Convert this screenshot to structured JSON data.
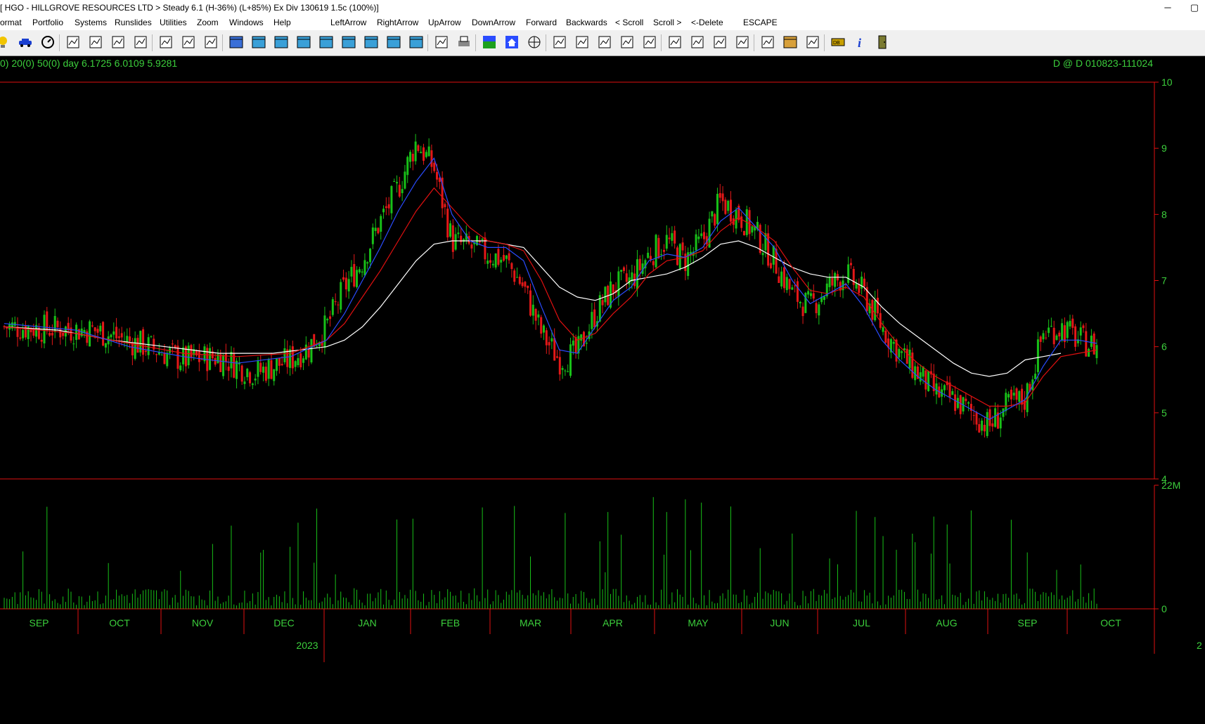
{
  "window": {
    "title": "[ HGO - HILLGROVE RESOURCES LTD > Steady 6.1 (H-36%) (L+85%)    Ex Div 130619  1.5c  (100%)]",
    "minimize_glyph": "─",
    "maximize_glyph": "▢"
  },
  "menu": {
    "items": [
      "ormat",
      "Portfolio",
      "Systems",
      "Runslides",
      "Utilities",
      "Zoom",
      "Windows",
      "Help"
    ],
    "nav_items": [
      "LeftArrow",
      "RightArrow",
      "UpArrow",
      "DownArrow",
      "Forward",
      "Backwards",
      "< Scroll",
      "Scroll >",
      "<-Delete",
      "ESCAPE"
    ]
  },
  "toolbar": {
    "buttons": [
      {
        "icon": "bulb-icon"
      },
      {
        "icon": "car-icon"
      },
      {
        "icon": "dial-icon"
      },
      {
        "icon": "chart-options-icon"
      },
      {
        "icon": "table-icon"
      },
      {
        "icon": "draw-trend-icon"
      },
      {
        "icon": "indicator-icon"
      },
      {
        "icon": "pfolio-icon"
      },
      {
        "icon": "grid-icon"
      },
      {
        "icon": "stats-icon"
      },
      {
        "icon": "window-icon"
      },
      {
        "icon": "cascade-icon"
      },
      {
        "icon": "tile-vertical-icon"
      },
      {
        "icon": "tile-horizontal-icon"
      },
      {
        "icon": "zoom-box-icon"
      },
      {
        "icon": "zoom-v-icon"
      },
      {
        "icon": "zoom-b-icon"
      },
      {
        "icon": "overlay-icon"
      },
      {
        "icon": "stack-icon"
      },
      {
        "icon": "print-preview-icon"
      },
      {
        "icon": "printer-icon"
      },
      {
        "icon": "map-icon"
      },
      {
        "icon": "home-icon"
      },
      {
        "icon": "web-icon"
      },
      {
        "icon": "scroll-left-full-icon"
      },
      {
        "icon": "scroll-left-icon"
      },
      {
        "icon": "scroll-back-icon"
      },
      {
        "icon": "scroll-right-icon"
      },
      {
        "icon": "scroll-right-full-icon"
      },
      {
        "icon": "dwm-icon"
      },
      {
        "icon": "log-lin-icon"
      },
      {
        "icon": "candle-icon"
      },
      {
        "icon": "show-trade-icon"
      },
      {
        "icon": "data-f12-icon"
      },
      {
        "icon": "hj-icon"
      },
      {
        "icon": "notes-icon"
      },
      {
        "icon": "database-icon"
      },
      {
        "icon": "info-icon"
      },
      {
        "icon": "exit-icon"
      }
    ]
  },
  "chart_header": {
    "left": "0) 20(0) 50(0)  day      6.1725  6.0109  5.9281",
    "right": "D @ D   010823-111024"
  },
  "colors": {
    "up": "#18c018",
    "down": "#e41818",
    "ma_fast": "#2a4cff",
    "ma_mid": "#e01010",
    "ma_slow": "#ffffff",
    "axis": "#e01010",
    "text": "#3ccf3c",
    "volume": "#18c018"
  },
  "chart_data": {
    "type": "candlestick",
    "series_note": "daily OHLC with three moving averages and volume",
    "price_axis": {
      "min": 4,
      "max": 10,
      "ticks": [
        4,
        5,
        6,
        7,
        8,
        9,
        10
      ]
    },
    "volume_axis": {
      "min": 0,
      "max": 22000000,
      "tick_labels": [
        "22M",
        "0"
      ]
    },
    "months": [
      "SEP",
      "OCT",
      "NOV",
      "DEC",
      "JAN",
      "FEB",
      "MAR",
      "APR",
      "MAY",
      "JUN",
      "JUL",
      "AUG",
      "SEP",
      "OCT"
    ],
    "year_label": "2023",
    "right_edge_label": "2",
    "close_path": [
      [
        0,
        6.3
      ],
      [
        5,
        6.25
      ],
      [
        8,
        6.0
      ],
      [
        10,
        5.8
      ],
      [
        12,
        5.85
      ],
      [
        14,
        5.6
      ],
      [
        16,
        5.8
      ],
      [
        17,
        6.0
      ],
      [
        18,
        6.3
      ],
      [
        19,
        6.9
      ],
      [
        20,
        7.3
      ],
      [
        21,
        7.9
      ],
      [
        22,
        8.4
      ],
      [
        23,
        9.1
      ],
      [
        24,
        8.7
      ],
      [
        25,
        7.6
      ],
      [
        27,
        7.4
      ],
      [
        28,
        7.3
      ],
      [
        29,
        6.9
      ],
      [
        30,
        6.2
      ],
      [
        31,
        5.8
      ],
      [
        32,
        5.9
      ],
      [
        33,
        6.5
      ],
      [
        34,
        6.9
      ],
      [
        35,
        7.0
      ],
      [
        36,
        7.4
      ],
      [
        37,
        7.6
      ],
      [
        38,
        7.3
      ],
      [
        39,
        7.6
      ],
      [
        40,
        8.2
      ],
      [
        41,
        8.0
      ],
      [
        42,
        7.7
      ],
      [
        43,
        7.3
      ],
      [
        44,
        6.8
      ],
      [
        45,
        6.6
      ],
      [
        46,
        6.9
      ],
      [
        47,
        7.1
      ],
      [
        48,
        6.8
      ],
      [
        49,
        6.3
      ],
      [
        50,
        5.9
      ],
      [
        51,
        5.6
      ],
      [
        52,
        5.3
      ],
      [
        53,
        5.2
      ],
      [
        54,
        5.0
      ],
      [
        55,
        4.8
      ],
      [
        56,
        5.1
      ],
      [
        57,
        5.2
      ],
      [
        58,
        6.2
      ],
      [
        59,
        6.3
      ],
      [
        60,
        6.1
      ],
      [
        61,
        6.0
      ]
    ],
    "ma_fast": [
      [
        0,
        6.35
      ],
      [
        4,
        6.25
      ],
      [
        7,
        6.0
      ],
      [
        10,
        5.85
      ],
      [
        13,
        5.75
      ],
      [
        16,
        5.85
      ],
      [
        18,
        6.1
      ],
      [
        19,
        6.5
      ],
      [
        20,
        7.0
      ],
      [
        21,
        7.5
      ],
      [
        22,
        8.05
      ],
      [
        23,
        8.5
      ],
      [
        24,
        8.85
      ],
      [
        25,
        8.0
      ],
      [
        26,
        7.6
      ],
      [
        27,
        7.5
      ],
      [
        28,
        7.5
      ],
      [
        29,
        7.3
      ],
      [
        30,
        6.6
      ],
      [
        31,
        5.95
      ],
      [
        32,
        5.9
      ],
      [
        33,
        6.3
      ],
      [
        34,
        6.7
      ],
      [
        35,
        6.9
      ],
      [
        36,
        7.3
      ],
      [
        37,
        7.4
      ],
      [
        38,
        7.35
      ],
      [
        39,
        7.5
      ],
      [
        40,
        7.9
      ],
      [
        41,
        8.1
      ],
      [
        42,
        7.8
      ],
      [
        43,
        7.5
      ],
      [
        44,
        7.0
      ],
      [
        45,
        6.65
      ],
      [
        46,
        6.8
      ],
      [
        47,
        6.95
      ],
      [
        48,
        6.6
      ],
      [
        49,
        6.1
      ],
      [
        50,
        5.8
      ],
      [
        51,
        5.55
      ],
      [
        52,
        5.35
      ],
      [
        53,
        5.2
      ],
      [
        54,
        5.05
      ],
      [
        55,
        4.9
      ],
      [
        56,
        5.05
      ],
      [
        57,
        5.2
      ],
      [
        58,
        5.7
      ],
      [
        59,
        6.1
      ],
      [
        60,
        6.1
      ],
      [
        61,
        6.05
      ]
    ],
    "ma_mid": [
      [
        0,
        6.3
      ],
      [
        4,
        6.2
      ],
      [
        7,
        6.05
      ],
      [
        10,
        5.9
      ],
      [
        13,
        5.85
      ],
      [
        16,
        5.9
      ],
      [
        18,
        6.1
      ],
      [
        19,
        6.35
      ],
      [
        20,
        6.75
      ],
      [
        21,
        7.15
      ],
      [
        22,
        7.6
      ],
      [
        23,
        8.05
      ],
      [
        24,
        8.4
      ],
      [
        25,
        8.1
      ],
      [
        26,
        7.8
      ],
      [
        27,
        7.6
      ],
      [
        28,
        7.55
      ],
      [
        29,
        7.45
      ],
      [
        30,
        7.0
      ],
      [
        31,
        6.4
      ],
      [
        32,
        6.1
      ],
      [
        33,
        6.2
      ],
      [
        34,
        6.5
      ],
      [
        35,
        6.75
      ],
      [
        36,
        7.1
      ],
      [
        37,
        7.3
      ],
      [
        38,
        7.35
      ],
      [
        39,
        7.45
      ],
      [
        40,
        7.75
      ],
      [
        41,
        7.95
      ],
      [
        42,
        7.8
      ],
      [
        43,
        7.6
      ],
      [
        44,
        7.2
      ],
      [
        45,
        6.85
      ],
      [
        46,
        6.8
      ],
      [
        47,
        6.9
      ],
      [
        48,
        6.75
      ],
      [
        49,
        6.35
      ],
      [
        50,
        6.0
      ],
      [
        51,
        5.75
      ],
      [
        52,
        5.55
      ],
      [
        53,
        5.4
      ],
      [
        54,
        5.25
      ],
      [
        55,
        5.1
      ],
      [
        56,
        5.1
      ],
      [
        57,
        5.15
      ],
      [
        58,
        5.55
      ],
      [
        59,
        5.85
      ],
      [
        60,
        5.9
      ],
      [
        61,
        5.95
      ]
    ],
    "ma_slow": [
      [
        0,
        6.3
      ],
      [
        3,
        6.25
      ],
      [
        6,
        6.1
      ],
      [
        9,
        6.0
      ],
      [
        12,
        5.9
      ],
      [
        15,
        5.9
      ],
      [
        18,
        6.0
      ],
      [
        19,
        6.1
      ],
      [
        20,
        6.3
      ],
      [
        21,
        6.6
      ],
      [
        22,
        6.95
      ],
      [
        23,
        7.3
      ],
      [
        24,
        7.55
      ],
      [
        25,
        7.6
      ],
      [
        27,
        7.6
      ],
      [
        29,
        7.5
      ],
      [
        30,
        7.2
      ],
      [
        31,
        6.9
      ],
      [
        32,
        6.75
      ],
      [
        33,
        6.7
      ],
      [
        34,
        6.8
      ],
      [
        35,
        7.0
      ],
      [
        36,
        7.05
      ],
      [
        37,
        7.1
      ],
      [
        38,
        7.2
      ],
      [
        39,
        7.35
      ],
      [
        40,
        7.55
      ],
      [
        41,
        7.6
      ],
      [
        42,
        7.5
      ],
      [
        43,
        7.35
      ],
      [
        44,
        7.2
      ],
      [
        45,
        7.1
      ],
      [
        46,
        7.05
      ],
      [
        47,
        7.05
      ],
      [
        48,
        6.9
      ],
      [
        49,
        6.6
      ],
      [
        50,
        6.35
      ],
      [
        51,
        6.15
      ],
      [
        52,
        5.95
      ],
      [
        53,
        5.75
      ],
      [
        54,
        5.6
      ],
      [
        55,
        5.55
      ],
      [
        56,
        5.6
      ],
      [
        57,
        5.8
      ],
      [
        58,
        5.85
      ],
      [
        59,
        5.9
      ]
    ]
  }
}
